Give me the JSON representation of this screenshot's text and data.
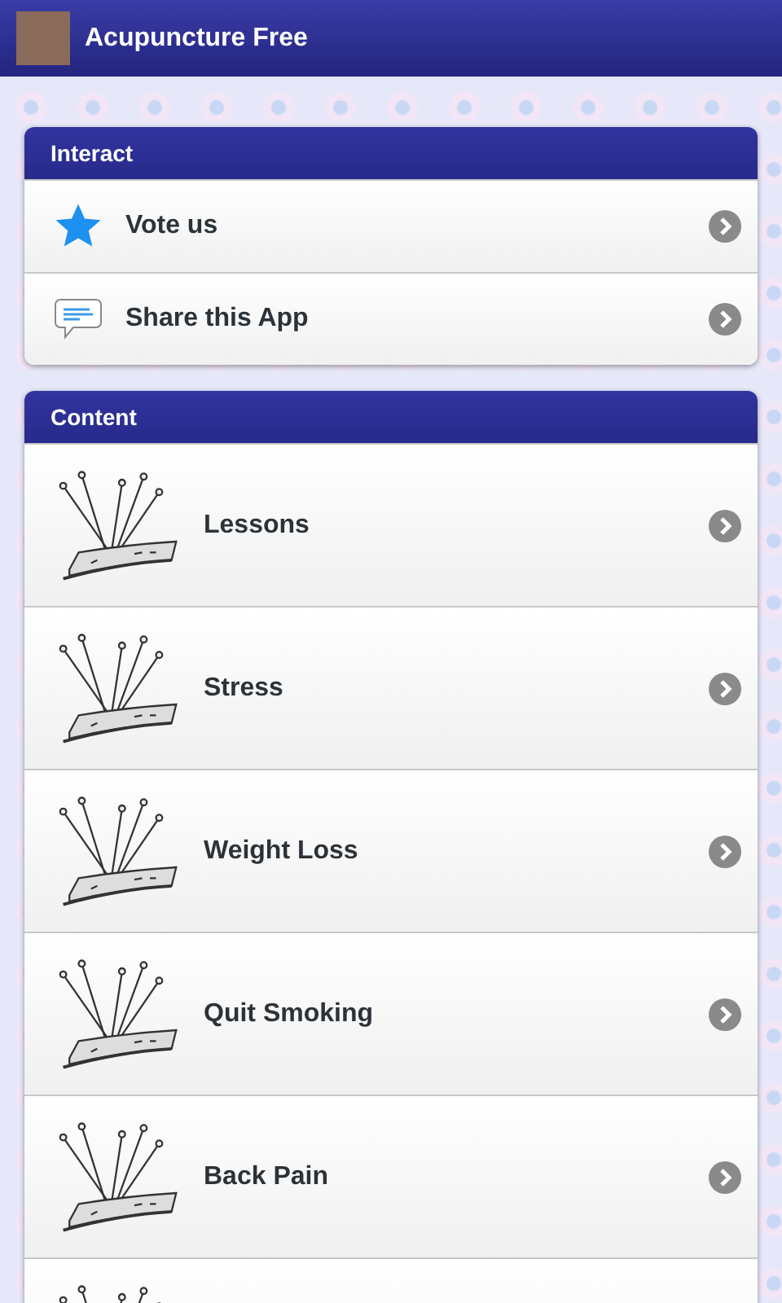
{
  "app_bar": {
    "title": "Acupuncture Free"
  },
  "sections": [
    {
      "title": "Interact",
      "kind": "small",
      "items": [
        {
          "label": "Vote us",
          "kind": "star"
        },
        {
          "label": "Share this App",
          "kind": "speech"
        }
      ]
    },
    {
      "title": "Content",
      "kind": "large",
      "items": [
        {
          "label": "Lessons",
          "kind": "needles"
        },
        {
          "label": "Stress",
          "kind": "needles"
        },
        {
          "label": "Weight Loss",
          "kind": "needles"
        },
        {
          "label": "Quit Smoking",
          "kind": "needles"
        },
        {
          "label": "Back Pain",
          "kind": "needles"
        },
        {
          "kind": "needles"
        }
      ]
    }
  ]
}
